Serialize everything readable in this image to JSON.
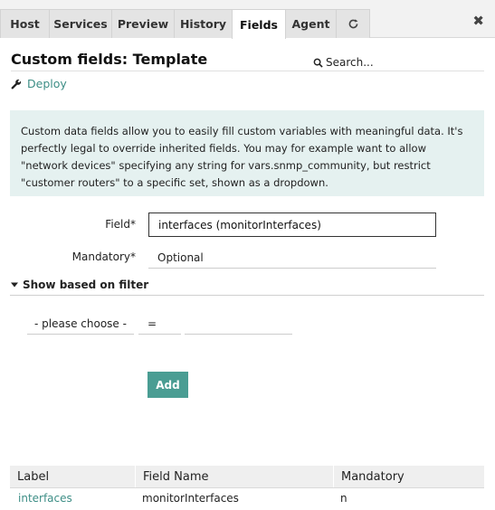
{
  "tabs": [
    {
      "label": "Host"
    },
    {
      "label": "Services"
    },
    {
      "label": "Preview"
    },
    {
      "label": "History"
    },
    {
      "label": "Fields",
      "active": true
    },
    {
      "label": "Agent"
    }
  ],
  "tab_refresh_icon": "refresh-icon",
  "close_icon": "close-icon",
  "page": {
    "title": "Custom fields: Template",
    "search_label": "Search...",
    "deploy_label": "Deploy"
  },
  "info_text": "Custom data fields allow you to easily fill custom variables with meaningful data. It's perfectly legal to override inherited fields. You may for example want to allow \"network devices\" specifying any string for vars.snmp_community, but restrict \"customer routers\" to a specific set, shown as a dropdown.",
  "form": {
    "field_label": "Field*",
    "field_value": "interfaces (monitorInterfaces)",
    "mandatory_label": "Mandatory*",
    "mandatory_value": "Optional",
    "filter_toggle": "Show based on filter",
    "filter_property": "- please choose -",
    "filter_operator": "=",
    "filter_value": "",
    "add_button": "Add"
  },
  "table": {
    "headers": [
      "Label",
      "Field Name",
      "Mandatory"
    ],
    "rows": [
      {
        "label": "interfaces",
        "field_name": "monitorInterfaces",
        "mandatory": "n"
      }
    ]
  },
  "colors": {
    "accent": "#4a9d93",
    "link": "#3d8e86",
    "info_bg": "#e5f1f0"
  }
}
